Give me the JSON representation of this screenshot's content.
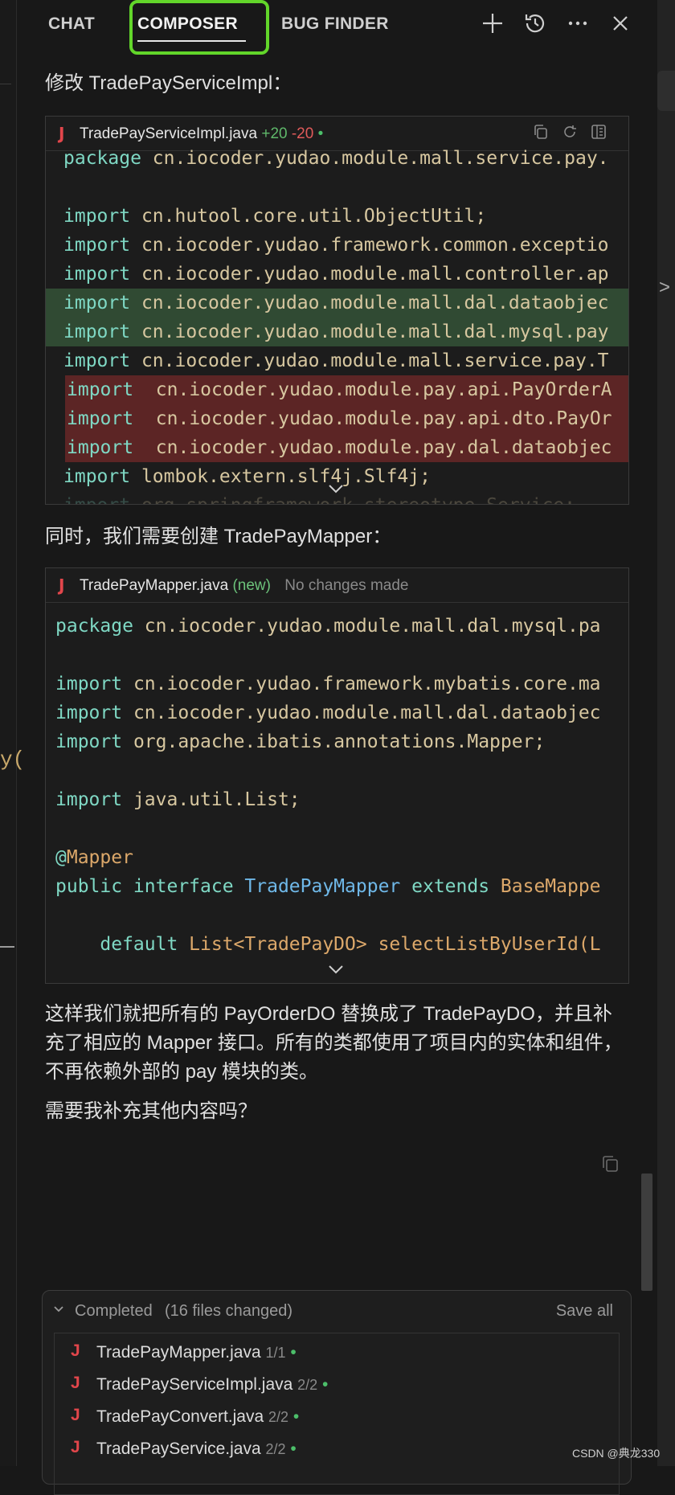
{
  "header": {
    "tabs": [
      "CHAT",
      "COMPOSER",
      "BUG FINDER"
    ],
    "icons": [
      "plus-icon",
      "history-icon",
      "more-icon",
      "close-icon"
    ]
  },
  "messages": {
    "intro1": "修改 TradePayServiceImpl：",
    "intro2": "同时，我们需要创建 TradePayMapper：",
    "summary": "这样我们就把所有的 PayOrderDO 替换成了 TradePayDO，并且补充了相应的 Mapper 接口。所有的类都使用了项目内的实体和组件，不再依赖外部的 pay 模块的类。",
    "question": "需要我补充其他内容吗？"
  },
  "file1": {
    "name": "TradePayServiceImpl.java",
    "added": "+20",
    "removed": "-20",
    "lines": [
      {
        "t": "ctx",
        "kw": "package",
        "rest": " cn.iocoder.yudao.module.mall.service.pay."
      },
      {
        "t": "ctx",
        "kw": "",
        "rest": ""
      },
      {
        "t": "ctx",
        "kw": "import",
        "rest": " cn.hutool.core.util.ObjectUtil;"
      },
      {
        "t": "ctx",
        "kw": "import",
        "rest": " cn.iocoder.yudao.framework.common.exceptio"
      },
      {
        "t": "ctx",
        "kw": "import",
        "rest": " cn.iocoder.yudao.module.mall.controller.ap"
      },
      {
        "t": "add",
        "kw": "import",
        "rest": " cn.iocoder.yudao.module.mall.dal.dataobjec"
      },
      {
        "t": "add",
        "kw": "import",
        "rest": " cn.iocoder.yudao.module.mall.dal.mysql.pay"
      },
      {
        "t": "ctx",
        "kw": "import",
        "rest": " cn.iocoder.yudao.module.mall.service.pay.T"
      },
      {
        "t": "del",
        "kw": "import",
        "rest": "  cn.iocoder.yudao.module.pay.api.PayOrderA"
      },
      {
        "t": "del",
        "kw": "import",
        "rest": "  cn.iocoder.yudao.module.pay.api.dto.PayOr"
      },
      {
        "t": "del",
        "kw": "import",
        "rest": "  cn.iocoder.yudao.module.pay.dal.dataobjec"
      },
      {
        "t": "ctx",
        "kw": "import",
        "rest": " lombok.extern.slf4j.Slf4j;"
      },
      {
        "t": "ctx",
        "kw": "import",
        "rest": " org.springframework.stereotype.Service;"
      }
    ]
  },
  "file2": {
    "name": "TradePayMapper.java",
    "tag": "(new)",
    "status": "No changes made",
    "lines": [
      {
        "kw": "package",
        "rest": " cn.iocoder.yudao.module.mall.dal.mysql.pa"
      },
      {
        "kw": "",
        "rest": ""
      },
      {
        "kw": "import",
        "rest": " cn.iocoder.yudao.framework.mybatis.core.ma"
      },
      {
        "kw": "import",
        "rest": " cn.iocoder.yudao.module.mall.dal.dataobjec"
      },
      {
        "kw": "import",
        "rest": " org.apache.ibatis.annotations.Mapper;"
      },
      {
        "kw": "",
        "rest": ""
      },
      {
        "kw": "import",
        "rest": " java.util.List;"
      },
      {
        "kw": "",
        "rest": ""
      },
      {
        "kw": "@",
        "rest": "Mapper"
      },
      {
        "kw": "public interface ",
        "type": "TradePayMapper",
        "kw2": " extends ",
        "rest": "BaseMappe"
      },
      {
        "kw": "",
        "rest": ""
      },
      {
        "kw": "    default ",
        "rest": "List<TradePayDO> selectListByUserId(",
        "tail": "L"
      }
    ]
  },
  "completed": {
    "label": "Completed",
    "count": "(16 files changed)",
    "save_all": "Save all",
    "files": [
      {
        "name": "TradePayMapper.java",
        "count": "1/1"
      },
      {
        "name": "TradePayServiceImpl.java",
        "count": "2/2"
      },
      {
        "name": "TradePayConvert.java",
        "count": "2/2"
      },
      {
        "name": "TradePayService.java",
        "count": "2/2"
      }
    ]
  },
  "watermark": "CSDN @典龙330",
  "colors": {
    "accent_green": "#62d62a",
    "java_icon": "#e2464b",
    "added": "#4cbf6a",
    "removed": "#e05a5a"
  }
}
